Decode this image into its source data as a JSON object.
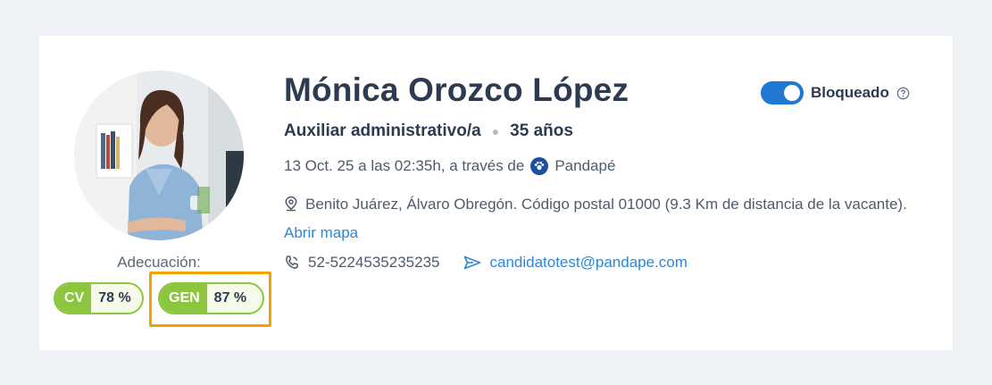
{
  "candidate": {
    "name": "Mónica Orozco López",
    "position": "Auxiliar administrativo/a",
    "age": "35 años",
    "applied_text": "13 Oct. 25 a las 02:35h, a través de",
    "source": "Pandapé",
    "address": "Benito Juárez, Álvaro Obregón. Código postal 01000 (9.3 Km de distancia de la vacante).",
    "map_link": "Abrir mapa",
    "phone": "52-5224535235235",
    "email": "candidatotest@pandape.com"
  },
  "adequacy": {
    "label": "Adecuación:",
    "badges": [
      {
        "code": "CV",
        "value": "78 %"
      },
      {
        "code": "GEN",
        "value": "87 %"
      }
    ]
  },
  "status_toggle": {
    "label": "Bloqueado",
    "on": true
  },
  "colors": {
    "accent": "#1f78d1",
    "link": "#2f86d6",
    "badge_green": "#8cc63f",
    "highlight": "#f5a100"
  },
  "icons": [
    "location-pin-icon",
    "phone-icon",
    "send-icon",
    "help-icon",
    "pandape-logo-icon"
  ]
}
